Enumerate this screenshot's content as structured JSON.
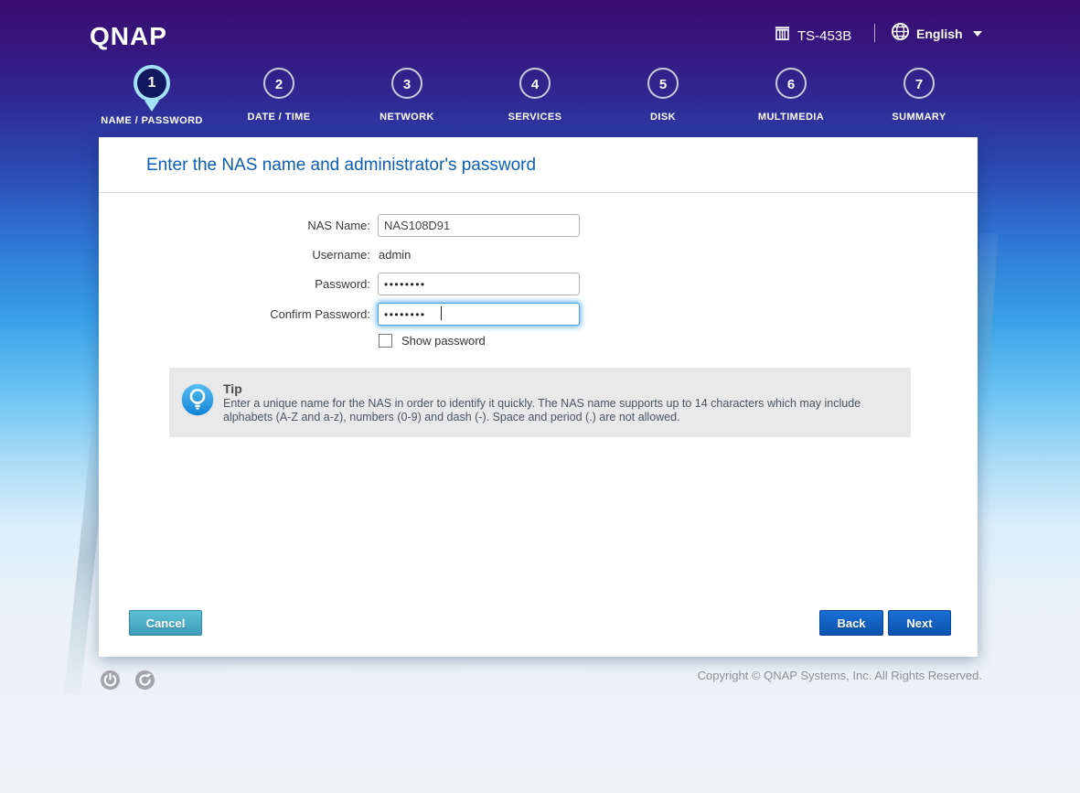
{
  "header": {
    "logo": "QNAP",
    "device_model": "TS-453B",
    "language": "English"
  },
  "stepper": {
    "active_step": 1,
    "steps": [
      {
        "number": "1",
        "label": "NAME / PASSWORD"
      },
      {
        "number": "2",
        "label": "DATE / TIME"
      },
      {
        "number": "3",
        "label": "NETWORK"
      },
      {
        "number": "4",
        "label": "SERVICES"
      },
      {
        "number": "5",
        "label": "DISK"
      },
      {
        "number": "6",
        "label": "MULTIMEDIA"
      },
      {
        "number": "7",
        "label": "SUMMARY"
      }
    ]
  },
  "card": {
    "title": "Enter the NAS name and administrator's password",
    "form": {
      "nas_name_label": "NAS Name:",
      "nas_name_value": "NAS108D91",
      "username_label": "Username:",
      "username_value": "admin",
      "password_label": "Password:",
      "password_value": "••••••••",
      "confirm_password_label": "Confirm Password:",
      "confirm_password_value": "••••••••",
      "show_password_label": "Show password",
      "show_password_checked": false
    },
    "tip": {
      "title": "Tip",
      "text": "Enter a unique name for the NAS in order to identify it quickly. The NAS name supports up to 14 characters which may include alphabets (A-Z and a-z), numbers (0-9) and dash (-). Space and period (.) are not allowed."
    },
    "buttons": {
      "cancel": "Cancel",
      "back": "Back",
      "next": "Next"
    }
  },
  "footer": {
    "copyright": "Copyright © QNAP Systems, Inc. All Rights Reserved."
  },
  "icons": {
    "nas_device": "nas-device-icon",
    "globe": "globe-icon",
    "chevron_down": "chevron-down-icon",
    "lightbulb": "lightbulb-icon",
    "power": "power-icon",
    "refresh": "refresh-icon"
  },
  "colors": {
    "top_purple": "#3a0d6e",
    "mid_blue": "#2e74d3",
    "light_blue": "#aadcf6",
    "title_blue": "#0d5fb4",
    "active_step_ring": "#a4e3f7",
    "active_step_fill": "#12175e",
    "inactive_step_ring": "#c9cdd6",
    "button_blue": "#0d52b0",
    "cancel_teal": "#3d9cb8",
    "tip_bg": "#e9e9e9",
    "tip_icon_blue": "#1f8fdd",
    "focus_glow": "#4aa3e0"
  }
}
